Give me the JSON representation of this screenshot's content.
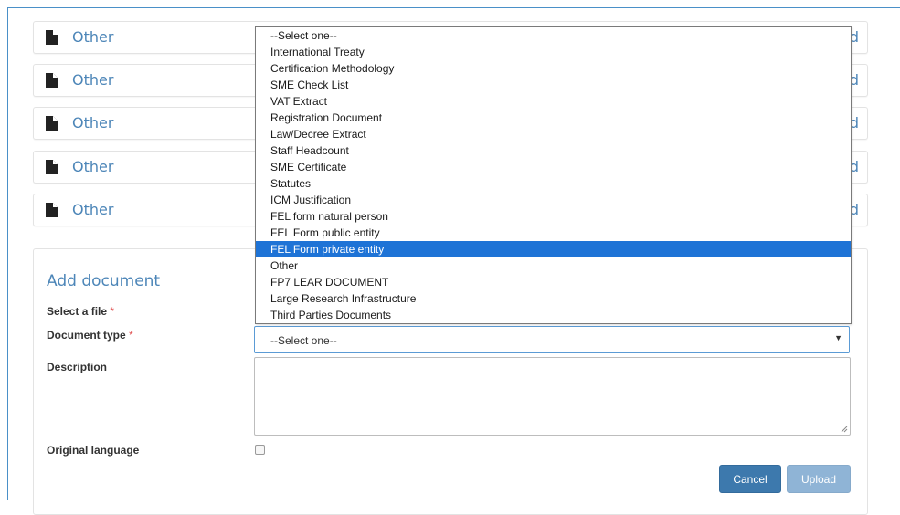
{
  "documents": [
    {
      "title": "Other",
      "edge_text": "d"
    },
    {
      "title": "Other",
      "edge_text": "d"
    },
    {
      "title": "Other",
      "edge_text": "d"
    },
    {
      "title": "Other",
      "edge_text": "d"
    },
    {
      "title": "Other",
      "edge_text": "d"
    }
  ],
  "add_document": {
    "title": "Add document",
    "select_file_label": "Select a file",
    "document_type_label": "Document type",
    "required_mark": "*",
    "description_label": "Description",
    "original_language_label": "Original language",
    "document_type_value": "--Select one--",
    "original_language_checked": false,
    "cancel_label": "Cancel",
    "upload_label": "Upload"
  },
  "dropdown": {
    "highlighted": "FEL Form private entity",
    "options": [
      "--Select one--",
      "International Treaty",
      "Certification Methodology",
      "SME Check List",
      "VAT Extract",
      "Registration Document",
      "Law/Decree Extract",
      "Staff Headcount",
      "SME Certificate",
      "Statutes",
      "ICM Justification",
      "FEL form natural person",
      "FEL Form public entity",
      "FEL Form private entity",
      "Other",
      "FP7 LEAR DOCUMENT",
      "Large Research Infrastructure",
      "Third Parties Documents"
    ]
  },
  "icons": {
    "document_row": "file-icon",
    "select_caret": "caret-down-icon",
    "textarea_resize": "resize-grip-icon"
  },
  "colors": {
    "accent": "#4d86b8",
    "primary_button": "#3d79ad",
    "disabled_button": "#8fb4d6",
    "highlight": "#1e73d6",
    "required": "#e05252"
  }
}
